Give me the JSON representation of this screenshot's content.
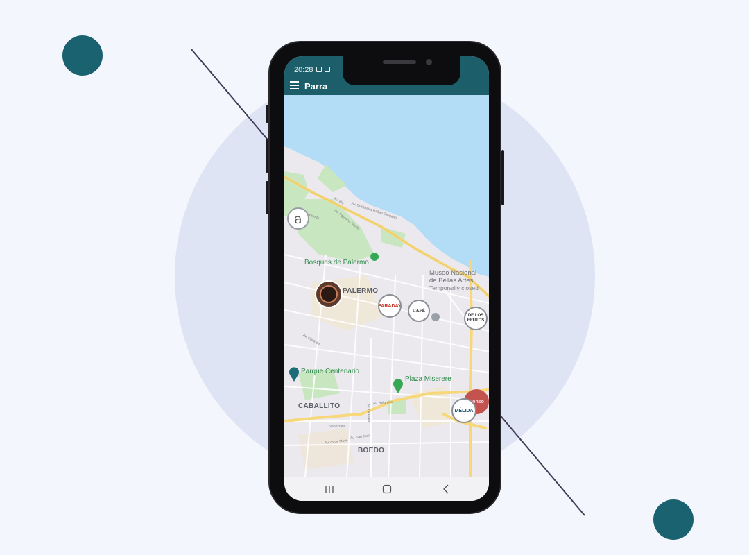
{
  "status_bar": {
    "time": "20:28"
  },
  "app_bar": {
    "title": "Parra",
    "menu_icon": "hamburger-menu-icon"
  },
  "map": {
    "places": {
      "bosques": "Bosques de Palermo",
      "palermo": "PALERMO",
      "museo_line1": "Museo Nacional",
      "museo_line2": "de Bellas Artes",
      "museo_status": "Temporarily closed",
      "parque": "Parque Centenario",
      "plaza": "Plaza Miserere",
      "caballito": "CABALLITO",
      "boedo": "BOEDO"
    },
    "streets": {
      "av_figueroa": "Av. Figueroa Alcorta",
      "av_costanera": "Av. Costanera Rafael Obligado",
      "au_illia": "Au. Illia",
      "av_sarmiento": "Av. Sarmiento",
      "av_cordoba": "Av. Córdoba",
      "av_belgrano": "Av. Belgrano",
      "av_san_juan": "Av. San Juan",
      "au_25_mayo": "Au 25 de Mayo",
      "venezuela": "Venezuela",
      "av_la_plata": "Av. La Plata"
    },
    "markers": {
      "a_logo": "a",
      "faraday": "FARADAY",
      "cafe": "CAFÉ",
      "de_los_frutos": "DE LOS FRUTOS",
      "melida": "MÉLIDA",
      "red": "Conso"
    },
    "colors": {
      "water": "#b3dcf7",
      "park": "#c8e6c0",
      "road_major": "#f6d77a",
      "road_minor": "#ffffff",
      "land": "#ece9ee"
    }
  },
  "nav_bar": {
    "recents_icon": "recents-icon",
    "home_icon": "home-icon",
    "back_icon": "back-icon"
  }
}
